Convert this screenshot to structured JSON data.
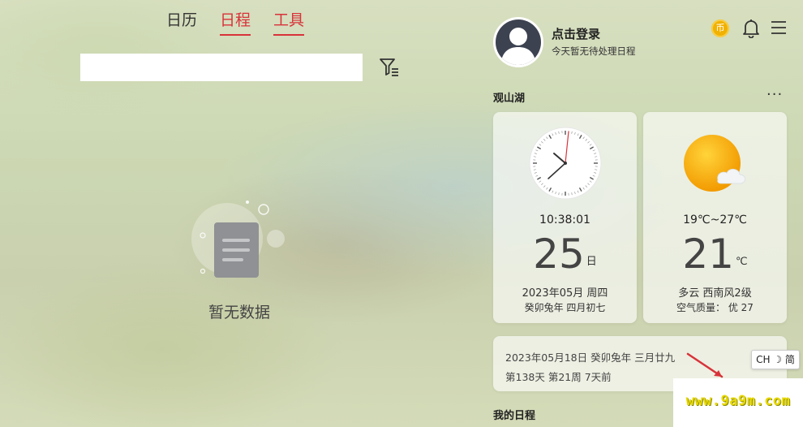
{
  "tabs": [
    {
      "label": "日历",
      "active": false
    },
    {
      "label": "日程",
      "active": true
    },
    {
      "label": "工具",
      "active": true
    }
  ],
  "search": {
    "value": "",
    "placeholder": ""
  },
  "empty_state": {
    "text": "暂无数据"
  },
  "user": {
    "title": "点击登录",
    "subtitle": "今天暂无待处理日程"
  },
  "header_icons": {
    "coin": "币"
  },
  "location": "观山湖",
  "more_label": "···",
  "clock_card": {
    "time": "10:38:01",
    "day": "25",
    "day_unit": "日",
    "date": "2023年05月 周四",
    "lunar": "癸卯兔年 四月初七"
  },
  "weather_card": {
    "range": "19℃~27℃",
    "temp": "21",
    "temp_unit": "℃",
    "condition": "多云 西南风2级",
    "air_quality": "空气质量： 优 27"
  },
  "date_info": {
    "line1": "2023年05月18日 癸卯兔年 三月廿九",
    "line2": "第138天 第21周 7天前"
  },
  "ime": {
    "label": "CH ☽ 简"
  },
  "watermark": "www.9a9m.com",
  "my_schedule": "我的日程",
  "colors": {
    "accent": "#d8333a",
    "sun": "#f5b800"
  }
}
